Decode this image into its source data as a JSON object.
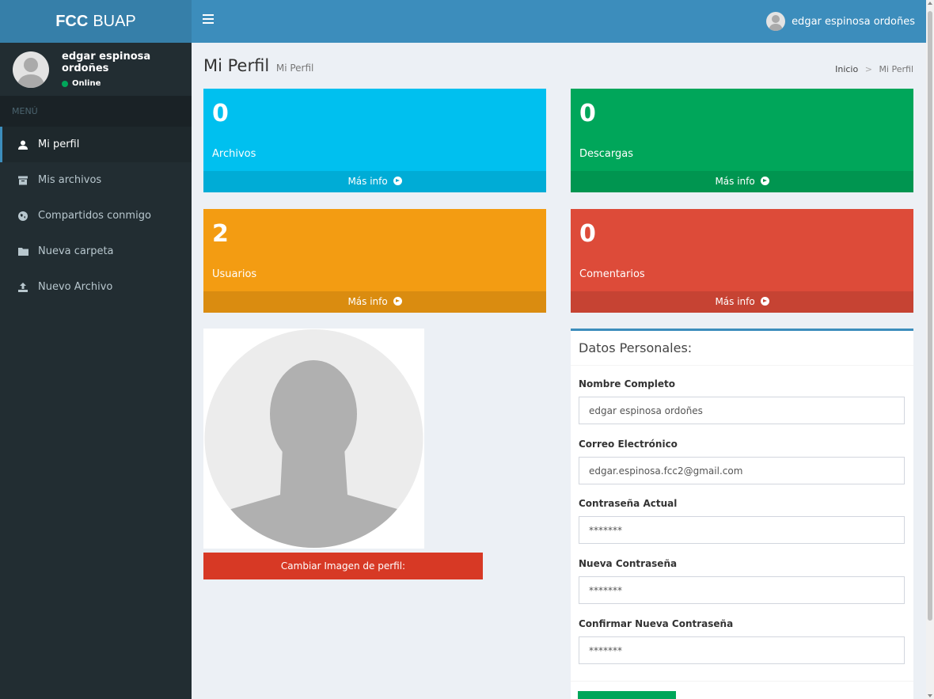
{
  "header": {
    "logo_bold": "FCC",
    "logo_text": "BUAP",
    "user_name": "edgar espinosa ordoñes"
  },
  "sidebar": {
    "user_name": "edgar espinosa ordoñes",
    "status": "Online",
    "menu_header": "MENÚ",
    "items": [
      {
        "label": "Mi perfil",
        "icon": "user-icon",
        "active": true
      },
      {
        "label": "Mis archivos",
        "icon": "archive-icon",
        "active": false
      },
      {
        "label": "Compartidos conmigo",
        "icon": "globe-icon",
        "active": false
      },
      {
        "label": "Nueva carpeta",
        "icon": "folder-icon",
        "active": false
      },
      {
        "label": "Nuevo Archivo",
        "icon": "upload-icon",
        "active": false
      }
    ]
  },
  "page": {
    "title": "Mi Perfil",
    "subtitle": "Mi Perfil",
    "breadcrumb": {
      "home": "Inicio",
      "current": "Mi Perfil"
    }
  },
  "stats": [
    {
      "value": "0",
      "label": "Archivos",
      "footer": "Más info",
      "color": "#00c0ef"
    },
    {
      "value": "0",
      "label": "Descargas",
      "footer": "Más info",
      "color": "#00a65a"
    },
    {
      "value": "2",
      "label": "Usuarios",
      "footer": "Más info",
      "color": "#f39c12"
    },
    {
      "value": "0",
      "label": "Comentarios",
      "footer": "Más info",
      "color": "#dd4b39"
    }
  ],
  "profile": {
    "change_image_label": "Cambiar Imagen de perfil:"
  },
  "form": {
    "title": "Datos Personales:",
    "fields": [
      {
        "label": "Nombre Completo",
        "value": "edgar espinosa ordoñes"
      },
      {
        "label": "Correo Electrónico",
        "value": "edgar.espinosa.fcc2@gmail.com"
      },
      {
        "label": "Contraseña Actual",
        "value": "*******"
      },
      {
        "label": "Nueva Contraseña",
        "value": "*******"
      },
      {
        "label": "Confirmar Nueva Contraseña",
        "value": "*******"
      }
    ]
  },
  "colors": {
    "primary": "#3c8dbc",
    "sidebar": "#222d32",
    "online": "#00a65a"
  }
}
